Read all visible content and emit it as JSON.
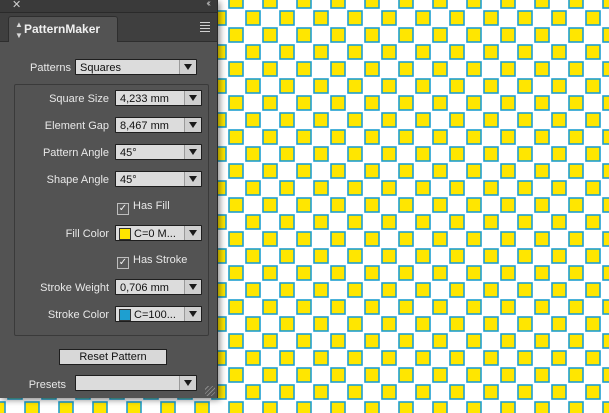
{
  "panel": {
    "title": "PatternMaker",
    "patterns_label": "Patterns",
    "patterns_value": "Squares",
    "fields": [
      {
        "label": "Square Size",
        "value": "4,233 mm"
      },
      {
        "label": "Element Gap",
        "value": "8,467 mm"
      },
      {
        "label": "Pattern Angle",
        "value": "45°"
      },
      {
        "label": "Shape Angle",
        "value": "45°"
      }
    ],
    "has_fill": {
      "label": "Has Fill",
      "checked": true
    },
    "fill_color": {
      "label": "Fill Color",
      "value": "C=0 M...",
      "swatch": "#ffe600"
    },
    "has_stroke": {
      "label": "Has Stroke",
      "checked": true
    },
    "stroke_weight": {
      "label": "Stroke Weight",
      "value": "0,706 mm"
    },
    "stroke_color": {
      "label": "Stroke Color",
      "value": "C=100...",
      "swatch": "#1e9fd0"
    },
    "reset_label": "Reset Pattern",
    "presets_label": "Presets",
    "presets_value": ""
  },
  "pattern": {
    "fill_color": "#ffe600",
    "stroke_color": "#1e9fd0"
  }
}
